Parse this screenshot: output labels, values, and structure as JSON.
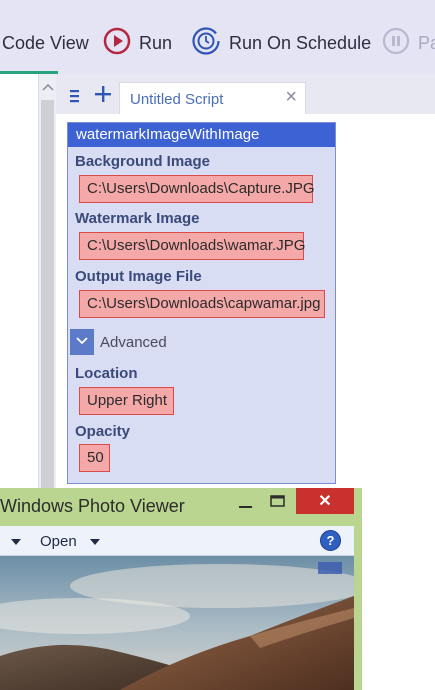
{
  "toolbar": {
    "code_view_label": "Code View",
    "run_label": "Run",
    "run_on_schedule_label": "Run On Schedule",
    "pause_label": "Pa",
    "accent_color": "#2ca37f",
    "run_icon_color": "#b3283f",
    "schedule_icon_color": "#2f55b5"
  },
  "tabs": {
    "menu_icon": "hamburger-icon",
    "add_icon": "plus-icon",
    "active_tab_label": "Untitled Script",
    "close_glyph": "×"
  },
  "node": {
    "title": "watermarkImageWithImage",
    "fields": [
      {
        "label": "Background Image",
        "value": "C:\\Users\\Downloads\\Capture.JPG"
      },
      {
        "label": "Watermark Image",
        "value": "C:\\Users\\Downloads\\wamar.JPG"
      },
      {
        "label": "Output Image File",
        "value": "C:\\Users\\Downloads\\capwamar.jpg"
      }
    ],
    "advanced_label": "Advanced",
    "advanced_fields": [
      {
        "label": "Location",
        "value": "Upper Right"
      },
      {
        "label": "Opacity",
        "value": "50"
      }
    ]
  },
  "photo_viewer": {
    "title": "Windows Photo Viewer",
    "menu_open_label": "Open",
    "help_label": "?",
    "close_glyph": "✕"
  }
}
